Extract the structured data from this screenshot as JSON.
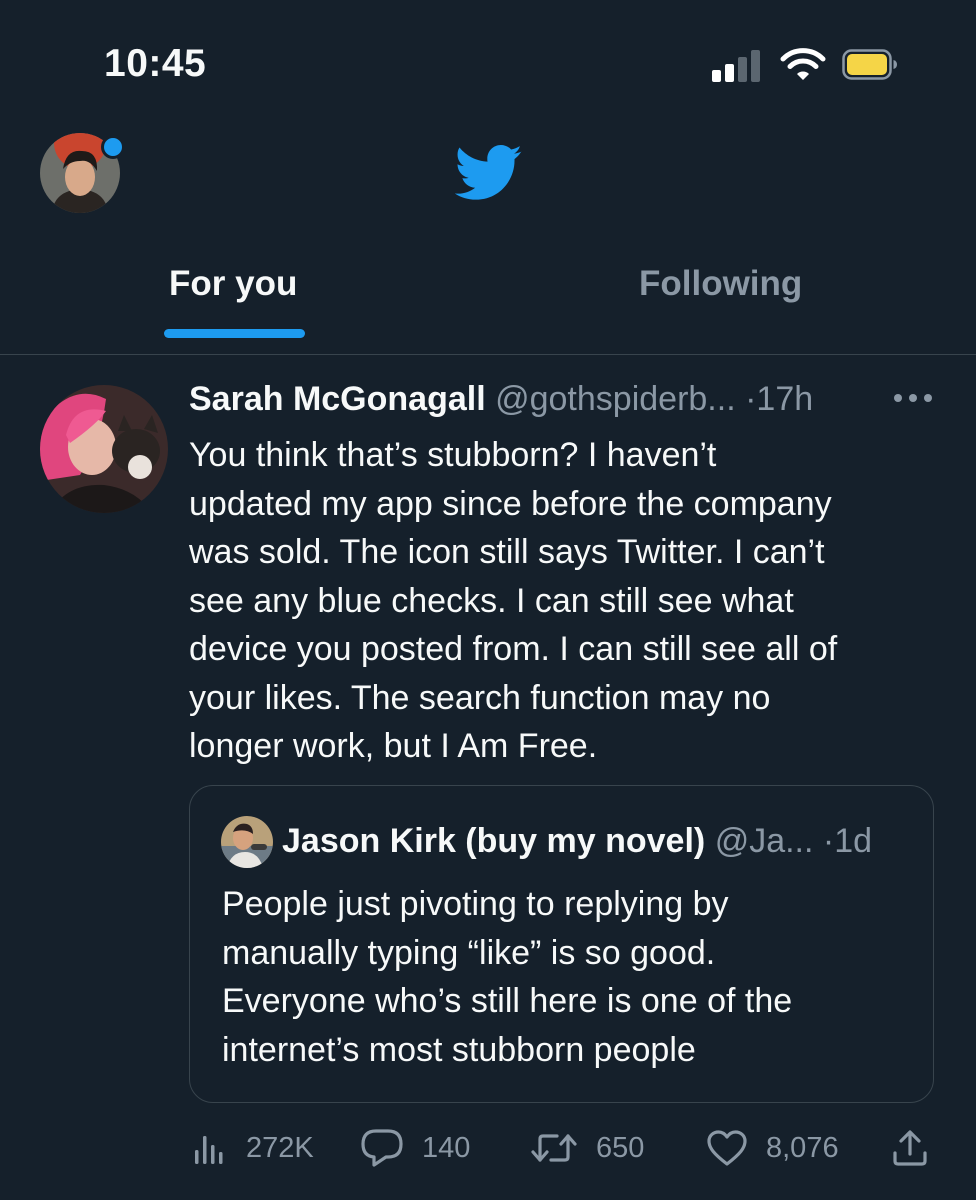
{
  "status_bar": {
    "time": "10:45"
  },
  "header": {
    "logo_icon": "twitter-bird-icon",
    "accent_color": "#1d9bf0"
  },
  "tabs": [
    {
      "label": "For you",
      "selected": true
    },
    {
      "label": "Following",
      "selected": false
    }
  ],
  "tweet": {
    "author_name": "Sarah McGonagall",
    "author_handle": "@gothspiderb...",
    "separator": "·",
    "time": "17h",
    "text": "You think that’s stubborn? I haven’t\nupdated my app since before the company\nwas sold. The icon still says Twitter. I can’t\nsee any blue checks. I can still see what\ndevice you posted from. I can still see all of\nyour likes. The search function may no\nlonger work, but I Am Free.",
    "quote": {
      "author_name": "Jason Kirk (buy my novel)",
      "author_handle": "@Ja...",
      "separator": "·",
      "time": "1d",
      "text": "People just pivoting to replying by\nmanually typing “like” is so good.\nEveryone who’s still here is one of the\ninternet’s most stubborn people"
    },
    "actions": {
      "views": "272K",
      "replies": "140",
      "retweets": "650",
      "likes": "8,076"
    }
  },
  "colors": {
    "background": "#15202b",
    "text": "#f7f9f9",
    "muted": "#8b98a5",
    "divider": "#38444d"
  }
}
